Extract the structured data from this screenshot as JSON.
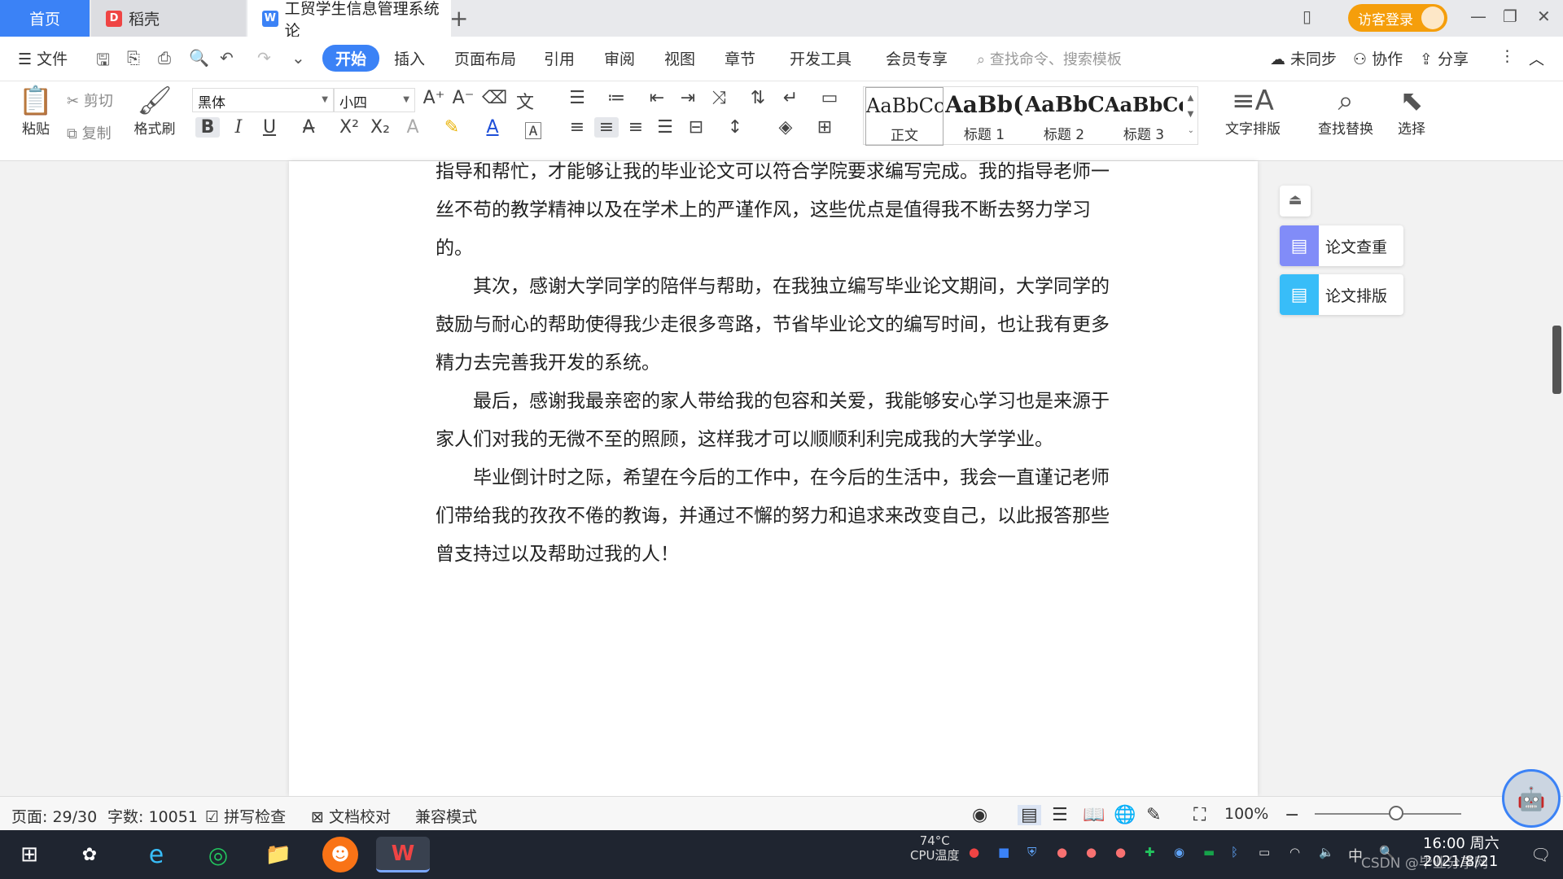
{
  "tabs": {
    "home": "首页",
    "daoke": "稻壳",
    "doc": "工贸学生信息管理系统论",
    "new_tab": "+"
  },
  "titlebar": {
    "login": "访客登录"
  },
  "menu": {
    "file": "文件",
    "items": [
      "开始",
      "插入",
      "页面布局",
      "引用",
      "审阅",
      "视图",
      "章节",
      "开发工具",
      "会员专享"
    ],
    "search_placeholder": "查找命令、搜索模板",
    "sync": "未同步",
    "collab": "协作",
    "share": "分享"
  },
  "ribbon": {
    "paste": "粘贴",
    "cut": "剪切",
    "copy": "复制",
    "format_painter": "格式刷",
    "font_name": "黑体",
    "font_size": "小四",
    "styles": [
      {
        "preview": "AaBbCcI",
        "name": "正文"
      },
      {
        "preview": "AaBb(",
        "name": "标题 1"
      },
      {
        "preview": "AaBbC",
        "name": "标题 2"
      },
      {
        "preview": "AaBbCcl",
        "name": "标题 3"
      }
    ],
    "text_layout": "文字排版",
    "find_replace": "查找替换",
    "select": "选择"
  },
  "document": {
    "paragraphs": [
      "指导和帮忙，才能够让我的毕业论文可以符合学院要求编写完成。我的指导老师一丝不苟的教学精神以及在学术上的严谨作风，这些优点是值得我不断去努力学习的。",
      "其次，感谢大学同学的陪伴与帮助，在我独立编写毕业论文期间，大学同学的鼓励与耐心的帮助使得我少走很多弯路，节省毕业论文的编写时间，也让我有更多精力去完善我开发的系统。",
      "最后，感谢我最亲密的家人带给我的包容和关爱，我能够安心学习也是来源于家人们对我的无微不至的照顾，这样我才可以顺顺利利完成我的大学学业。",
      "毕业倒计时之际，希望在今后的工作中，在今后的生活中，我会一直谨记老师们带给我的孜孜不倦的教诲，并通过不懈的努力和追求来改变自己，以此报答那些曾支持过以及帮助过我的人！"
    ]
  },
  "side_panel": {
    "plagiarism_check": "论文查重",
    "thesis_layout": "论文排版"
  },
  "statusbar": {
    "page": "页面: 29/30",
    "word_count": "字数: 10051",
    "spell_check": "拼写检查",
    "doc_proof": "文档校对",
    "compat_mode": "兼容模式",
    "zoom": "100%"
  },
  "taskbar": {
    "cpu_temp": "74°C",
    "cpu_label": "CPU温度",
    "ime": "中",
    "time": "16:00 周六",
    "date": "2021/8/21",
    "watermark": "CSDN @毕业分享网"
  },
  "colors": {
    "accent": "#3b82f6",
    "login_orange": "#f59e0b",
    "taskbar": "#1f2530"
  }
}
